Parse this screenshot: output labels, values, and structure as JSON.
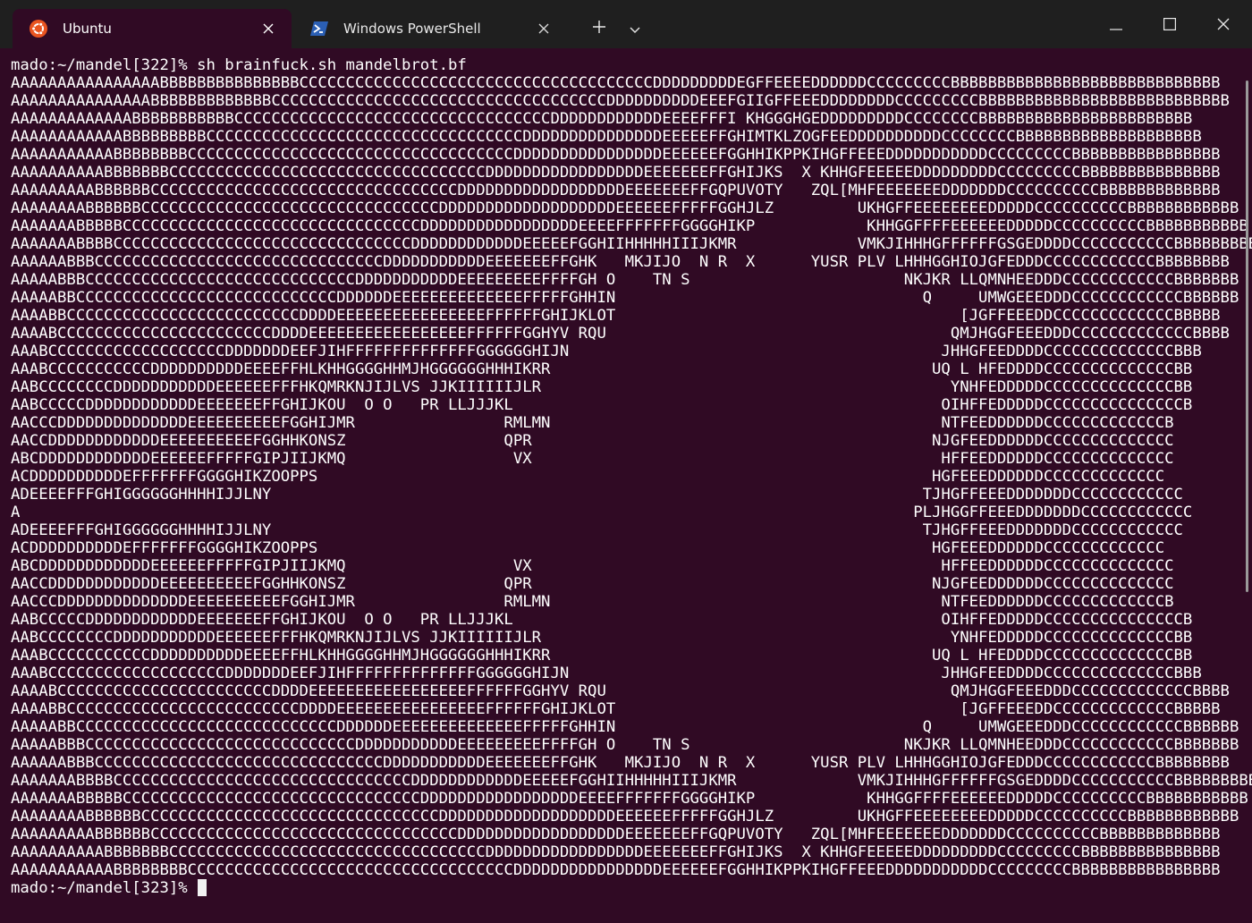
{
  "tabs": [
    {
      "label": "Ubuntu",
      "icon": "ubuntu-icon",
      "active": true
    },
    {
      "label": "Windows PowerShell",
      "icon": "powershell-icon",
      "active": false
    }
  ],
  "colors": {
    "terminal_bg": "#300a24",
    "ubuntu_orange": "#e95420",
    "powershell_blue": "#2b5fb4"
  },
  "terminal": {
    "command_line": "mado:~/mandel[322]% sh brainfuck.sh mandelbrot.bf",
    "output": [
      "AAAAAAAAAAAAAAAABBBBBBBBBBBBBBBCCCCCCCCCCCCCCCCCCCCCCCCCCCCCCCCCCCCCCDDDDDDDDDEGFFEEEEDDDDDDCCCCCCCCCBBBBBBBBBBBBBBBBBBBBBBBBBBBBB",
      "AAAAAAAAAAAAAAABBBBBBBBBBBBBCCCCCCCCCCCCCCCCCCCCCCCCCCCCCCCCCCCCDDDDDDDDDDEEEFGIIGFFEEEDDDDDDDDCCCCCCCCCBBBBBBBBBBBBBBBBBBBBBBBBBBB",
      "AAAAAAAAAAAAABBBBBBBBBBBCCCCCCCCCCCCCCCCCCCCCCCCCCCCCCCCCCDDDDDDDDDDDDEEEEFFFI KHGGGHGEDDDDDDDDDCCCCCCCCBBBBBBBBBBBBBBBBBBBBBBB",
      "AAAAAAAAAAAABBBBBBBBBCCCCCCCCCCCCCCCCCCCCCCCCCCCCCCCCCCDDDDDDDDDDDDDDDEEEEEFFGHIMTKLZOGFEEDDDDDDDDDDCCCCCCCCBBBBBBBBBBBBBBBBBBBB",
      "AAAAAAAAAAABBBBBBBBCCCCCCCCCCCCCCCCCCCCCCCCCCCCCCCCCCCDDDDDDDDDDDDDDDDEEEEEEFGGHHIKPPKIHGFFEEEDDDDDDDDDDDCCCCCCCCCBBBBBBBBBBBBBBBB",
      "AAAAAAAAAABBBBBBBCCCCCCCCCCCCCCCCCCCCCCCCCCCCCCCCCCDDDDDDDDDDDDDDDDDEEEEEEEFFGHIJKS  X KHHGFEEEEEDDDDDDDDDCCCCCCCCCBBBBBBBBBBBBBBB",
      "AAAAAAAAABBBBBBCCCCCCCCCCCCCCCCCCCCCCCCCCCCCCCCCDDDDDDDDDDDDDDDDDDEEEEEEEFFGQPUVOTY   ZQL[MHFEEEEEEEDDDDDDDCCCCCCCCCCBBBBBBBBBBBBB",
      "AAAAAAAABBBBBBCCCCCCCCCCCCCCCCCCCCCCCCCCCCCCCCDDDDDDDDDDDDDDDDDDDEEEEEEFFFFFGGHJLZ         UKHGFFEEEEEEEEDDDDDCCCCCCCCCCBBBBBBBBBBBB",
      "AAAAAAABBBBBCCCCCCCCCCCCCCCCCCCCCCCCCCCCCCCCDDDDDDDDDDDDDDDDDEEEEFFFFFFFGGGGHIKP            KHHGGFFFFEEEEEEDDDDDCCCCCCCCCCBBBBBBBBBBB",
      "AAAAAAABBBBCCCCCCCCCCCCCCCCCCCCCCCCCCCCCCCCDDDDDDDDDDDDEEEEEFGGHIIHHHHHIIIJKMR             VMKJIHHHGFFFFFFGSGEDDDDCCCCCCCCCCCBBBBBBBBB",
      "AAAAAABBBCCCCCCCCCCCCCCCCCCCCCCCCCCCCCCCDDDDDDDDDDDEEEEEEEFFGHK   MKJIJO  N R  X      YUSR PLV LHHHGGHIOJGFEDDDCCCCCCCCCCCCBBBBBBBB",
      "AAAAABBBCCCCCCCCCCCCCCCCCCCCCCCCCCCCCDDDDDDDDDDDEEEEEEEEEFFFFGH O    TN S                       NKJKR LLQMNHEEDDDCCCCCCCCCCCCBBBBBBB",
      "AAAAABBCCCCCCCCCCCCCCCCCCCCCCCCCCCCDDDDDDEEEEEEEEEEEEEEFFFFFGHHIN                                 Q     UMWGEEEDDDCCCCCCCCCCCCBBBBBB",
      "AAAABBCCCCCCCCCCCCCCCCCCCCCCCCCDDDDEEEEEEEEEEEEEEEEFFFFFFGHIJKLOT                                     [JGFFEEEDDCCCCCCCCCCCCCBBBBB",
      "AAAABCCCCCCCCCCCCCCCCCCCCCCCDDDDEEEEEEEEEEEEEEEEEFFFFFFGGHYV RQU                                     QMJHGGFEEEDDDCCCCCCCCCCCCCBBBB",
      "AAABCCCCCCCCCCCCCCCCCCCDDDDDDDEEFJIHFFFFFFFFFFFFFFGGGGGGHIJN                                        JHHGFEEDDDDCCCCCCCCCCCCCCBBB",
      "AAABCCCCCCCCCCCDDDDDDDDDDEEEEFFHLKHHGGGGHHMJHGGGGGGHHHIKRR                                         UQ L HFEDDDDCCCCCCCCCCCCCCBB",
      "AABCCCCCCCCDDDDDDDDDDDEEEEEEFFFHKQMRKNJIJLVS JJKIIIIIIJLR                                            YNHFEDDDDDCCCCCCCCCCCCCCBB",
      "AABCCCCCDDDDDDDDDDDDEEEEEEEFFGHIJKOU  O O   PR LLJJJKL                                              OIHFFEDDDDDCCCCCCCCCCCCCCCB",
      "AACCCDDDDDDDDDDDDDDEEEEEEEEEEFGGHIJMR                RMLMN                                          NTFEEDDDDDDCCCCCCCCCCCCCB",
      "AACCDDDDDDDDDDDDEEEEEEEEEEFGGHHKONSZ                 QPR                                           NJGFEEDDDDDDCCCCCCCCCCCCCC",
      "ABCDDDDDDDDDDDDEEEEEEFFFFFGIPJIIJKMQ                  VX                                            HFFEEDDDDDDCCCCCCCCCCCCCC",
      "ACDDDDDDDDDDEFFFFFFFGGGGHIKZOOPPS                                                                  HGFEEEDDDDDDCCCCCCCCCCCCC",
      "ADEEEEFFFGHIGGGGGGHHHHIJJLNY                                                                      TJHGFFEEEDDDDDDDCCCCCCCCCCCC",
      "A                                                                                                PLJHGGFFEEEDDDDDDDCCCCCCCCCCCC",
      "ADEEEEFFFGHIGGGGGGHHHHIJJLNY                                                                      TJHGFFEEEDDDDDDDCCCCCCCCCCCC",
      "ACDDDDDDDDDDEFFFFFFFGGGGHIKZOOPPS                                                                  HGFEEEDDDDDDCCCCCCCCCCCCC",
      "ABCDDDDDDDDDDDDEEEEEEFFFFFGIPJIIJKMQ                  VX                                            HFFEEDDDDDDCCCCCCCCCCCCCC",
      "AACCDDDDDDDDDDDDEEEEEEEEEEFGGHHKONSZ                 QPR                                           NJGFEEDDDDDDCCCCCCCCCCCCCC",
      "AACCCDDDDDDDDDDDDDDEEEEEEEEEEFGGHIJMR                RMLMN                                          NTFEEDDDDDDCCCCCCCCCCCCCB",
      "AABCCCCCDDDDDDDDDDDDEEEEEEEFFGHIJKOU  O O   PR LLJJJKL                                              OIHFFEDDDDDCCCCCCCCCCCCCCCB",
      "AABCCCCCCCCDDDDDDDDDDDEEEEEEFFFHKQMRKNJIJLVS JJKIIIIIIJLR                                            YNHFEDDDDDCCCCCCCCCCCCCCBB",
      "AAABCCCCCCCCCCCDDDDDDDDDDEEEEFFHLKHHGGGGHHMJHGGGGGGHHHIKRR                                         UQ L HFEDDDDCCCCCCCCCCCCCCBB",
      "AAABCCCCCCCCCCCCCCCCCCCDDDDDDDEEFJIHFFFFFFFFFFFFFFGGGGGGHIJN                                        JHHGFEEDDDDCCCCCCCCCCCCCCBBB",
      "AAAABCCCCCCCCCCCCCCCCCCCCCCCDDDDEEEEEEEEEEEEEEEEEFFFFFFGGHYV RQU                                     QMJHGGFEEEDDDCCCCCCCCCCCCCBBBB",
      "AAAABBCCCCCCCCCCCCCCCCCCCCCCCCCDDDDEEEEEEEEEEEEEEEEFFFFFFGHIJKLOT                                     [JGFFEEEDDCCCCCCCCCCCCCBBBBB",
      "AAAAABBCCCCCCCCCCCCCCCCCCCCCCCCCCCCDDDDDDEEEEEEEEEEEEEEFFFFFGHHIN                                 Q     UMWGEEEDDDCCCCCCCCCCCCBBBBBB",
      "AAAAABBBCCCCCCCCCCCCCCCCCCCCCCCCCCCCCDDDDDDDDDDDEEEEEEEEEFFFFGH O    TN S                       NKJKR LLQMNHEEDDDCCCCCCCCCCCCBBBBBBB",
      "AAAAAABBBCCCCCCCCCCCCCCCCCCCCCCCCCCCCCCCDDDDDDDDDDDEEEEEEEFFGHK   MKJIJO  N R  X      YUSR PLV LHHHGGHIOJGFEDDDCCCCCCCCCCCCBBBBBBBB",
      "AAAAAAABBBBCCCCCCCCCCCCCCCCCCCCCCCCCCCCCCCCDDDDDDDDDDDDEEEEEFGGHIIHHHHHIIIJKMR             VMKJIHHHGFFFFFFGSGEDDDDCCCCCCCCCCCBBBBBBBBB",
      "AAAAAAABBBBBCCCCCCCCCCCCCCCCCCCCCCCCCCCCCCCCDDDDDDDDDDDDDDDDDEEEEFFFFFFFGGGGHIKP            KHHGGFFFFEEEEEEDDDDDCCCCCCCCCCBBBBBBBBBBB",
      "AAAAAAAABBBBBBCCCCCCCCCCCCCCCCCCCCCCCCCCCCCCCCDDDDDDDDDDDDDDDDDDDEEEEEEFFFFFGGHJLZ         UKHGFFEEEEEEEEDDDDDCCCCCCCCCCBBBBBBBBBBBB",
      "AAAAAAAAABBBBBBCCCCCCCCCCCCCCCCCCCCCCCCCCCCCCCCCDDDDDDDDDDDDDDDDDDEEEEEEEFFGQPUVOTY   ZQL[MHFEEEEEEEDDDDDDDCCCCCCCCCCBBBBBBBBBBBBB",
      "AAAAAAAAAABBBBBBBCCCCCCCCCCCCCCCCCCCCCCCCCCCCCCCCCCDDDDDDDDDDDDDDDDDEEEEEEEFFGHIJKS  X KHHGFEEEEEDDDDDDDDDCCCCCCCCCBBBBBBBBBBBBBBB",
      "AAAAAAAAAAABBBBBBBBCCCCCCCCCCCCCCCCCCCCCCCCCCCCCCCCCCCDDDDDDDDDDDDDDDDEEEEEEFGGHHIKPPKIHGFFEEEDDDDDDDDDDDCCCCCCCCCBBBBBBBBBBBBBBBB"
    ],
    "final_prompt": "mado:~/mandel[323]% "
  }
}
